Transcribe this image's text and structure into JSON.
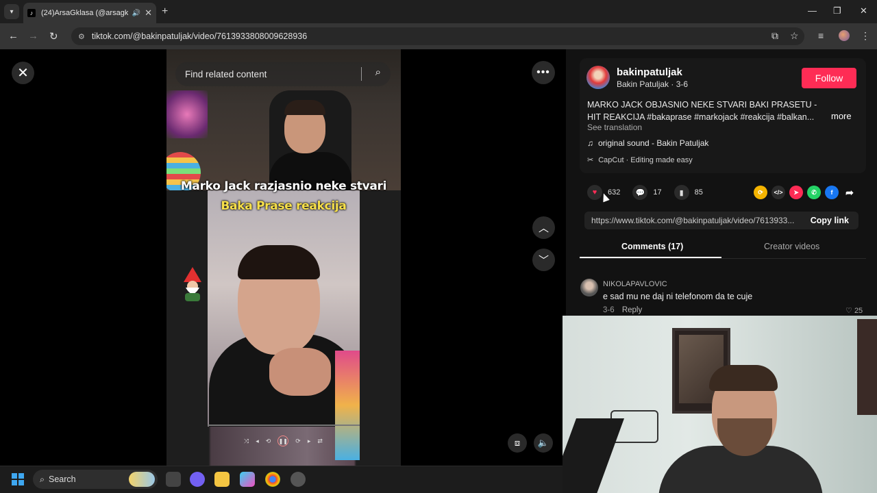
{
  "browser": {
    "tab_title": "(24)ArsaGklasa (@arsagklas",
    "tab_favicon": "tiktok-icon",
    "new_tab": "+",
    "url": "tiktok.com/@bakinpatuljak/video/7613933808009628936"
  },
  "player": {
    "search_placeholder": "Find related content",
    "caption_line1": "Marko Jack razjasnio neke stvari",
    "caption_line2": "Baka Prase reakcija"
  },
  "post": {
    "username": "bakinpatuljak",
    "display_sub": "Bakin Patuljak · 3-6",
    "follow_label": "Follow",
    "description": "MARKO JACK OBJASNIO NEKE STVARI BAKI PRASETU - HIT REAKCIJA #bakaprase #markojack #reakcija #balkan...",
    "more_label": "more",
    "see_translation": "See translation",
    "music": "original sound - Bakin Patuljak",
    "capcut": "CapCut · Editing made easy",
    "likes": "632",
    "comments": "17",
    "saves": "85",
    "link": "https://www.tiktok.com/@bakinpatuljak/video/7613933...",
    "copy_link": "Copy link"
  },
  "tabs": {
    "comments": "Comments (17)",
    "creator": "Creator videos"
  },
  "comment": {
    "user": "NIKOLAPAVLOVIC",
    "text": "e sad mu ne daj ni telefonom da te cuje",
    "date": "3-6",
    "reply": "Reply",
    "likes": "25"
  },
  "taskbar": {
    "search": "Search"
  },
  "colors": {
    "follow": "#fe2c55",
    "caption_yellow": "#f7e04a"
  }
}
